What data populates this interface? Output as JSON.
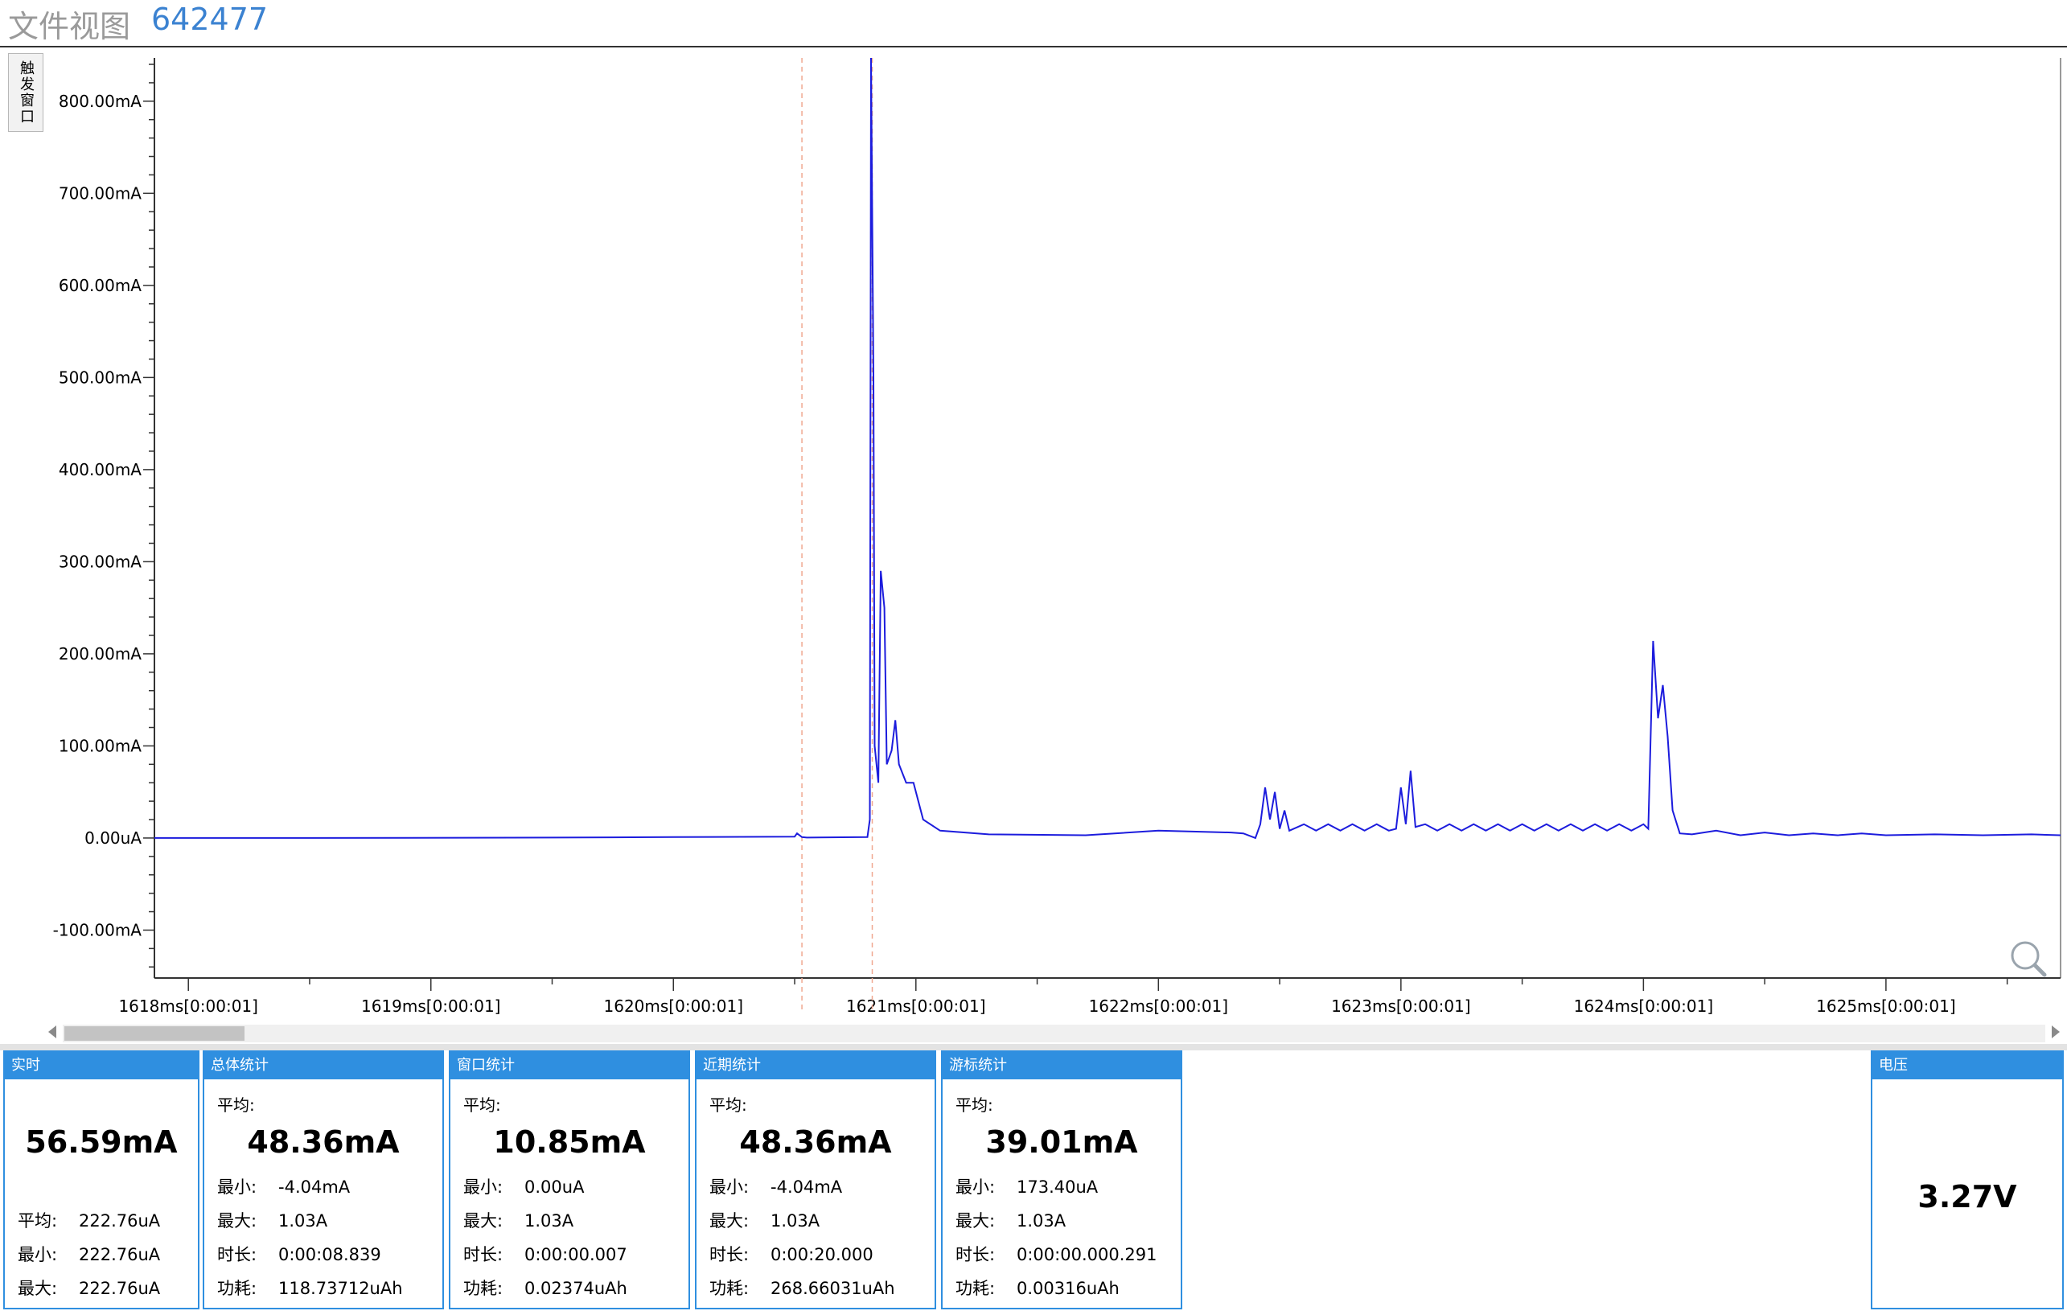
{
  "title": {
    "menu": "文件视图",
    "device_id": "642477"
  },
  "trigger_tab": {
    "label": "触发窗口"
  },
  "chart_data": {
    "type": "line",
    "yticks": [
      "800.00mA",
      "700.00mA",
      "600.00mA",
      "500.00mA",
      "400.00mA",
      "300.00mA",
      "200.00mA",
      "100.00mA",
      "0.00uA",
      "-100.00mA"
    ],
    "ytick_values": [
      800,
      700,
      600,
      500,
      400,
      300,
      200,
      100,
      0,
      -100
    ],
    "ylim": [
      -152,
      847
    ],
    "xticks": [
      "1618ms[0:00:01]",
      "1619ms[0:00:01]",
      "1620ms[0:00:01]",
      "1621ms[0:00:01]",
      "1622ms[0:00:01]",
      "1623ms[0:00:01]",
      "1624ms[0:00:01]",
      "1625ms[0:00:01]"
    ],
    "xtick_values": [
      1618,
      1619,
      1620,
      1621,
      1622,
      1623,
      1624,
      1625
    ],
    "xlim": [
      1617.86,
      1625.72
    ],
    "markers_x": [
      1620.53,
      1620.82
    ],
    "series": [
      {
        "color": "#1c1cdd",
        "points": [
          [
            1617.86,
            0
          ],
          [
            1618.5,
            0
          ],
          [
            1619.5,
            0.5
          ],
          [
            1620.0,
            1
          ],
          [
            1620.5,
            1.5
          ],
          [
            1620.51,
            5
          ],
          [
            1620.53,
            1
          ],
          [
            1620.55,
            0.5
          ],
          [
            1620.8,
            1
          ],
          [
            1620.81,
            20
          ],
          [
            1620.815,
            847
          ],
          [
            1620.825,
            500
          ],
          [
            1620.83,
            100
          ],
          [
            1620.845,
            60
          ],
          [
            1620.855,
            290
          ],
          [
            1620.87,
            250
          ],
          [
            1620.88,
            80
          ],
          [
            1620.9,
            95
          ],
          [
            1620.915,
            128
          ],
          [
            1620.93,
            80
          ],
          [
            1620.96,
            60
          ],
          [
            1620.99,
            60
          ],
          [
            1621.03,
            20
          ],
          [
            1621.1,
            8
          ],
          [
            1621.3,
            4
          ],
          [
            1621.7,
            3
          ],
          [
            1622.0,
            8
          ],
          [
            1622.3,
            6
          ],
          [
            1622.35,
            5
          ],
          [
            1622.4,
            0
          ],
          [
            1622.42,
            15
          ],
          [
            1622.44,
            55
          ],
          [
            1622.46,
            20
          ],
          [
            1622.48,
            50
          ],
          [
            1622.5,
            10
          ],
          [
            1622.52,
            30
          ],
          [
            1622.54,
            8
          ],
          [
            1622.6,
            15
          ],
          [
            1622.65,
            8
          ],
          [
            1622.7,
            15
          ],
          [
            1622.75,
            8
          ],
          [
            1622.8,
            15
          ],
          [
            1622.85,
            8
          ],
          [
            1622.9,
            15
          ],
          [
            1622.95,
            8
          ],
          [
            1622.98,
            10
          ],
          [
            1623.0,
            55
          ],
          [
            1623.02,
            15
          ],
          [
            1623.04,
            73
          ],
          [
            1623.06,
            12
          ],
          [
            1623.1,
            15
          ],
          [
            1623.15,
            8
          ],
          [
            1623.2,
            15
          ],
          [
            1623.25,
            8
          ],
          [
            1623.3,
            15
          ],
          [
            1623.35,
            8
          ],
          [
            1623.4,
            15
          ],
          [
            1623.45,
            8
          ],
          [
            1623.5,
            15
          ],
          [
            1623.55,
            8
          ],
          [
            1623.6,
            15
          ],
          [
            1623.65,
            8
          ],
          [
            1623.7,
            15
          ],
          [
            1623.75,
            8
          ],
          [
            1623.8,
            15
          ],
          [
            1623.85,
            8
          ],
          [
            1623.9,
            15
          ],
          [
            1623.95,
            8
          ],
          [
            1624.0,
            15
          ],
          [
            1624.02,
            10
          ],
          [
            1624.04,
            214
          ],
          [
            1624.06,
            130
          ],
          [
            1624.08,
            166
          ],
          [
            1624.1,
            110
          ],
          [
            1624.12,
            30
          ],
          [
            1624.15,
            5
          ],
          [
            1624.2,
            4
          ],
          [
            1624.3,
            8
          ],
          [
            1624.4,
            3
          ],
          [
            1624.5,
            6
          ],
          [
            1624.6,
            3
          ],
          [
            1624.7,
            5
          ],
          [
            1624.8,
            3
          ],
          [
            1624.9,
            5
          ],
          [
            1625.0,
            3
          ],
          [
            1625.2,
            4
          ],
          [
            1625.4,
            3
          ],
          [
            1625.6,
            4
          ],
          [
            1625.72,
            3
          ]
        ]
      }
    ]
  },
  "zoom_icon": "magnifier-icon",
  "panels": {
    "realtime": {
      "title": "实时",
      "value": "56.59mA",
      "rows": [
        {
          "k": "平均:",
          "v": "222.76uA"
        },
        {
          "k": "最小:",
          "v": "222.76uA"
        },
        {
          "k": "最大:",
          "v": "222.76uA"
        }
      ]
    },
    "total": {
      "title": "总体统计",
      "avg_label": "平均:",
      "value": "48.36mA",
      "rows": [
        {
          "k": "最小:",
          "v": "-4.04mA"
        },
        {
          "k": "最大:",
          "v": "1.03A"
        },
        {
          "k": "时长:",
          "v": "0:00:08.839"
        },
        {
          "k": "功耗:",
          "v": "118.73712uAh"
        }
      ]
    },
    "window": {
      "title": "窗口统计",
      "avg_label": "平均:",
      "value": "10.85mA",
      "rows": [
        {
          "k": "最小:",
          "v": "0.00uA"
        },
        {
          "k": "最大:",
          "v": "1.03A"
        },
        {
          "k": "时长:",
          "v": "0:00:00.007"
        },
        {
          "k": "功耗:",
          "v": "0.02374uAh"
        }
      ]
    },
    "recent": {
      "title": "近期统计",
      "avg_label": "平均:",
      "value": "48.36mA",
      "rows": [
        {
          "k": "最小:",
          "v": "-4.04mA"
        },
        {
          "k": "最大:",
          "v": "1.03A"
        },
        {
          "k": "时长:",
          "v": "0:00:20.000"
        },
        {
          "k": "功耗:",
          "v": "268.66031uAh"
        }
      ]
    },
    "cursor": {
      "title": "游标统计",
      "avg_label": "平均:",
      "value": "39.01mA",
      "rows": [
        {
          "k": "最小:",
          "v": "173.40uA"
        },
        {
          "k": "最大:",
          "v": "1.03A"
        },
        {
          "k": "时长:",
          "v": "0:00:00.000.291"
        },
        {
          "k": "功耗:",
          "v": "0.00316uAh"
        }
      ]
    },
    "voltage": {
      "title": "电压",
      "value": "3.27V"
    }
  }
}
